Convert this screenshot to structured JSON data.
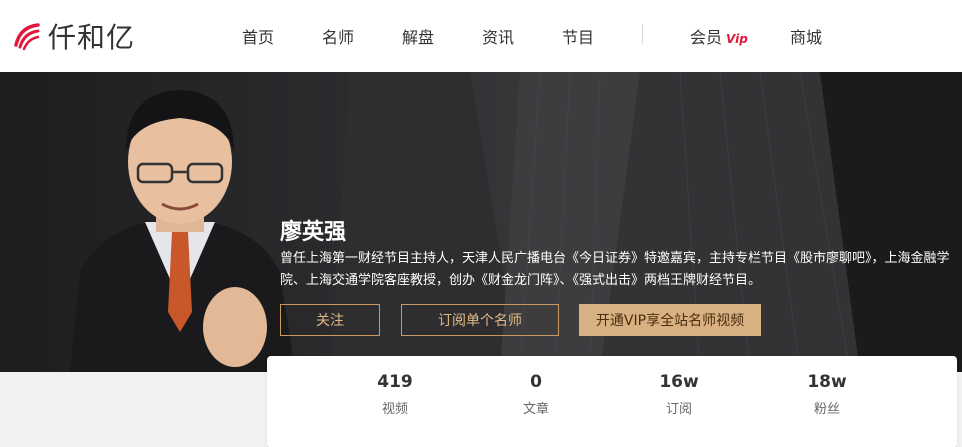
{
  "header": {
    "logo_text": "仟和亿",
    "nav": [
      {
        "label": "首页"
      },
      {
        "label": "名师"
      },
      {
        "label": "解盘"
      },
      {
        "label": "资讯"
      },
      {
        "label": "节目"
      }
    ],
    "member_label": "会员",
    "member_badge": "Vip",
    "mall_label": "商城"
  },
  "profile": {
    "name": "廖英强",
    "description": "曾任上海第一财经节目主持人，天津人民广播电台《今日证券》特邀嘉宾，主持专栏节目《股市廖聊吧》，上海金融学院、上海交通学院客座教授，创办《财金龙门阵》、《强式出击》两档王牌财经节目。",
    "buttons": {
      "follow": "关注",
      "subscribe": "订阅单个名师",
      "vip": "开通VIP享全站名师视频"
    }
  },
  "stats": [
    {
      "value": "419",
      "label": "视频"
    },
    {
      "value": "0",
      "label": "文章"
    },
    {
      "value": "16w",
      "label": "订阅"
    },
    {
      "value": "18w",
      "label": "粉丝"
    }
  ],
  "colors": {
    "brand_red": "#e0193c",
    "gold": "#d9b081",
    "gold_border": "#c89a62"
  }
}
